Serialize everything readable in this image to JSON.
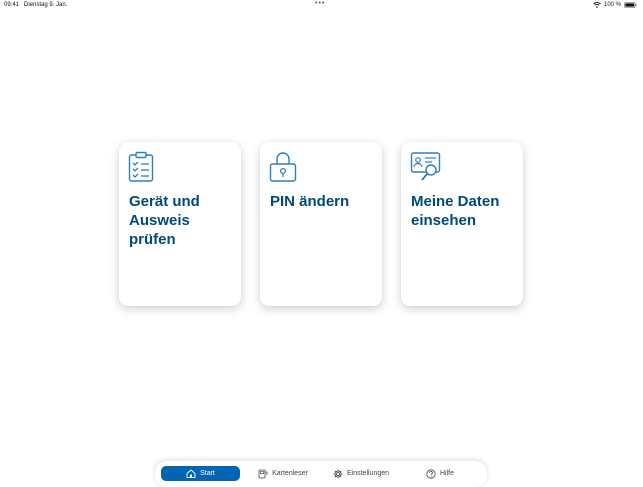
{
  "status_bar": {
    "time": "09:41",
    "date": "Dienstag 9. Jan.",
    "battery": "100 %"
  },
  "cards": [
    {
      "title": "Gerät und Ausweis prüfen",
      "icon": "checklist-icon"
    },
    {
      "title": "PIN ändern",
      "icon": "lock-icon"
    },
    {
      "title": "Meine Daten einsehen",
      "icon": "id-card-search-icon"
    }
  ],
  "tabbar": {
    "items": [
      {
        "label": "Start",
        "icon": "home-icon",
        "active": true
      },
      {
        "label": "Kartenleser",
        "icon": "card-reader-icon",
        "active": false
      },
      {
        "label": "Einstellungen",
        "icon": "gear-icon",
        "active": false
      },
      {
        "label": "Hilfe",
        "icon": "help-icon",
        "active": false
      }
    ]
  },
  "colors": {
    "accent": "#0066b3",
    "title": "#004a7c",
    "icon": "#2e7fbf"
  }
}
